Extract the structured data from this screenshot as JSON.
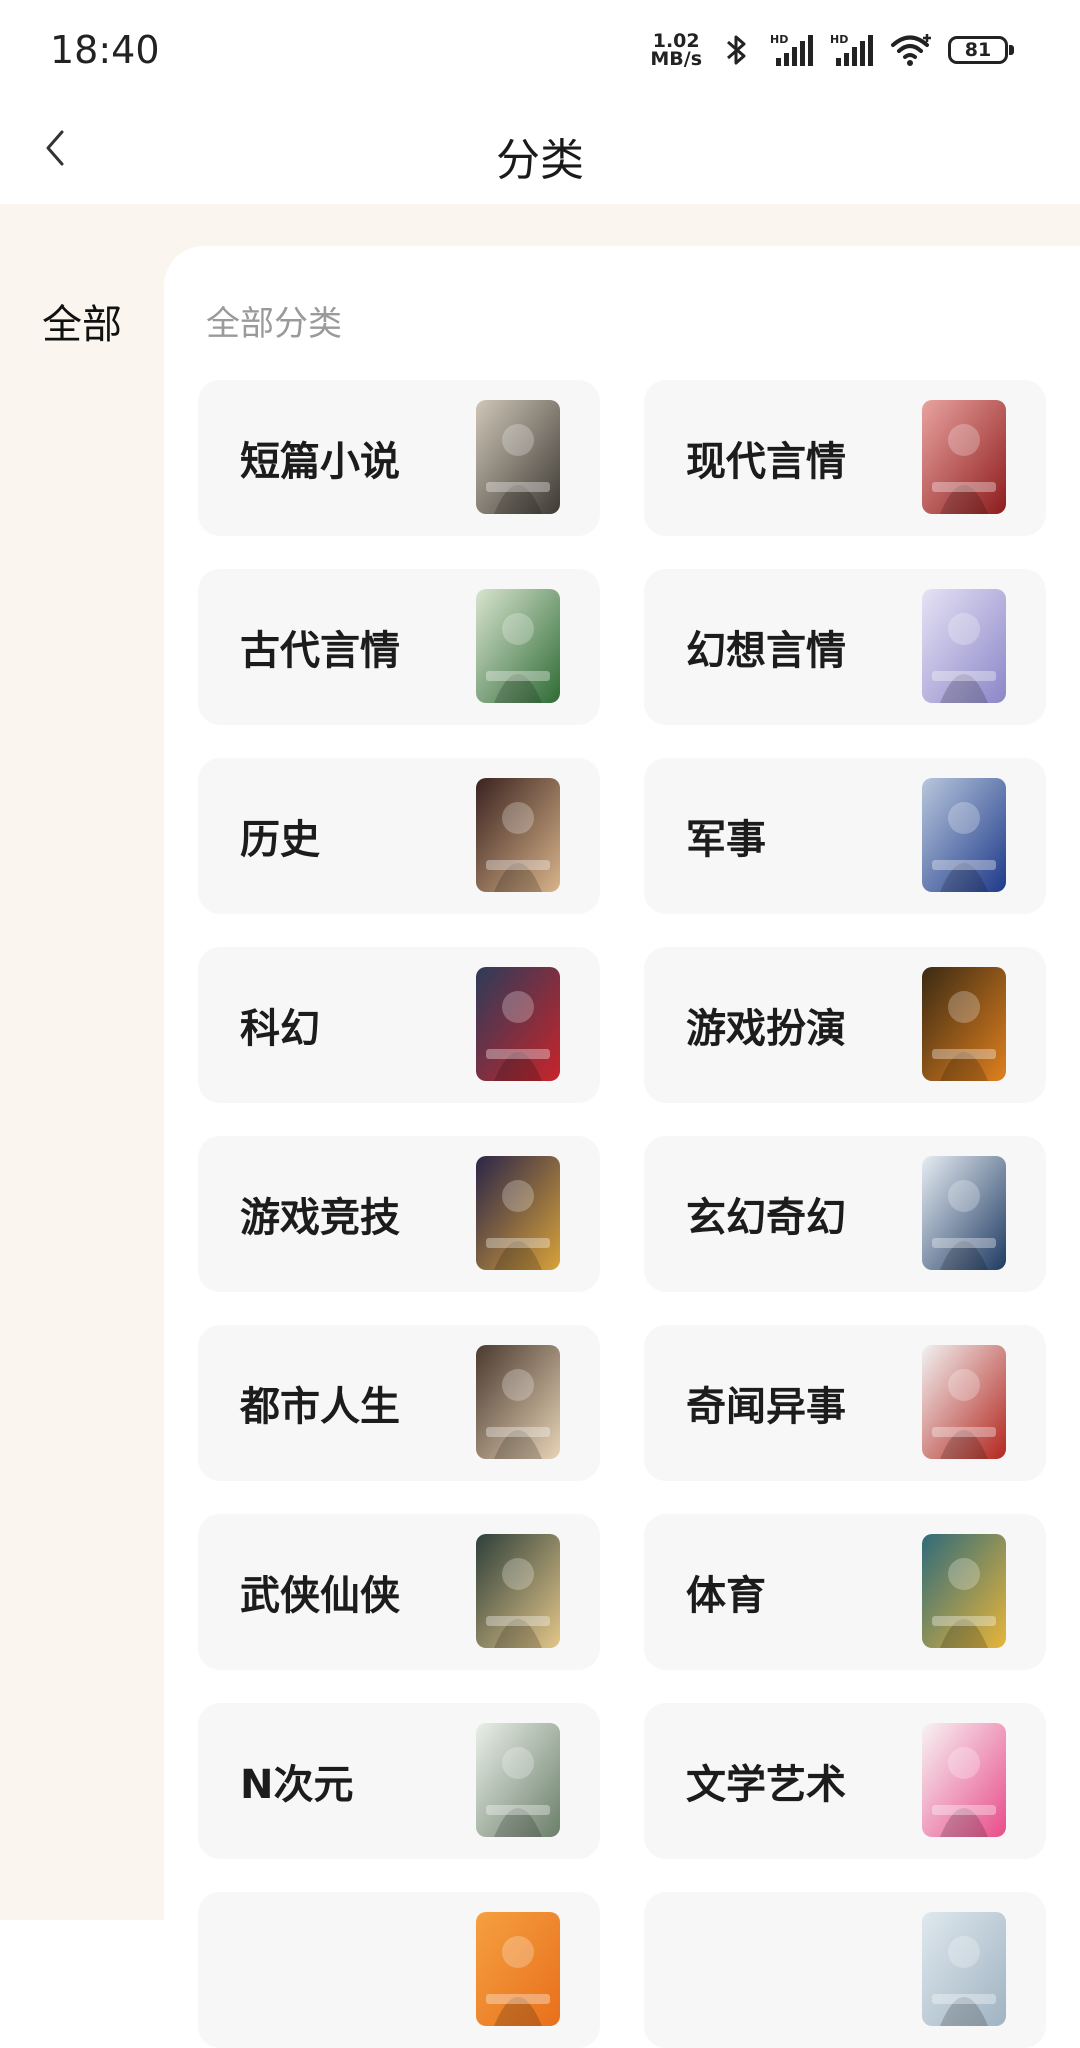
{
  "status_bar": {
    "time": "18:40",
    "net_speed_value": "1.02",
    "net_speed_unit": "MB/s",
    "bluetooth_icon": "bluetooth-icon",
    "signal_label_1": "HD",
    "signal_label_2": "HD",
    "wifi_icon": "wifi-icon",
    "battery_level": "81"
  },
  "header": {
    "back_icon": "chevron-left-icon",
    "title": "分类"
  },
  "side_nav": {
    "items": [
      {
        "label": "全部",
        "selected": true
      }
    ]
  },
  "main": {
    "section_title": "全部分类",
    "categories": [
      {
        "label": "短篇小说",
        "cover": [
          "#cfc6b7",
          "#3d3a34"
        ]
      },
      {
        "label": "现代言情",
        "cover": [
          "#e9a3a0",
          "#8d1c1c"
        ]
      },
      {
        "label": "古代言情",
        "cover": [
          "#d8e4cf",
          "#2f6b35"
        ]
      },
      {
        "label": "幻想言情",
        "cover": [
          "#e6e2f5",
          "#8b86c8"
        ]
      },
      {
        "label": "历史",
        "cover": [
          "#3a2320",
          "#d9b48a"
        ]
      },
      {
        "label": "军事",
        "cover": [
          "#b8c7dc",
          "#1e3a8a"
        ]
      },
      {
        "label": "科幻",
        "cover": [
          "#2c3c5a",
          "#c8242a"
        ]
      },
      {
        "label": "游戏扮演",
        "cover": [
          "#3a2a14",
          "#e0801e"
        ]
      },
      {
        "label": "游戏竞技",
        "cover": [
          "#2b2548",
          "#d8a23a"
        ]
      },
      {
        "label": "玄幻奇幻",
        "cover": [
          "#e6ecf2",
          "#1f3b63"
        ]
      },
      {
        "label": "都市人生",
        "cover": [
          "#4a3a30",
          "#e7d3b6"
        ]
      },
      {
        "label": "奇闻异事",
        "cover": [
          "#f1f1f1",
          "#b3261e"
        ]
      },
      {
        "label": "武侠仙侠",
        "cover": [
          "#2e3f3a",
          "#e3c689"
        ]
      },
      {
        "label": "体育",
        "cover": [
          "#2f6b7a",
          "#e8b53a"
        ]
      },
      {
        "label": "N次元",
        "cover": [
          "#e9efe8",
          "#6b7f6a"
        ]
      },
      {
        "label": "文学艺术",
        "cover": [
          "#f7f3f4",
          "#e84c8a"
        ]
      },
      {
        "label": "",
        "cover": [
          "#f5a040",
          "#e86f1c"
        ]
      },
      {
        "label": "",
        "cover": [
          "#dfe8ee",
          "#9fb3c2"
        ]
      }
    ]
  }
}
